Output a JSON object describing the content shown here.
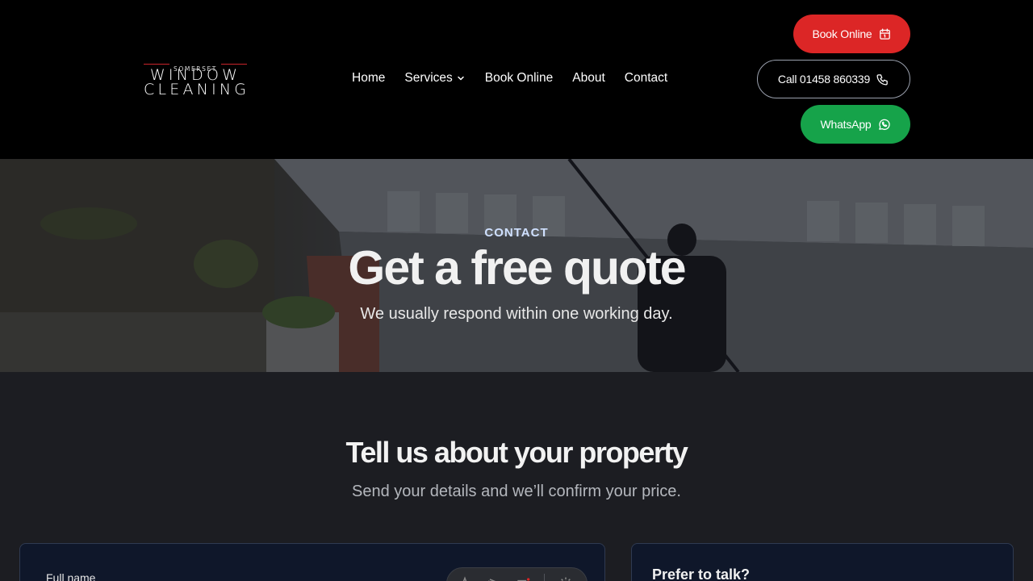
{
  "brand": {
    "logo_top": "SOMERSET",
    "logo_line1": "WINDOW",
    "logo_line2": "CLEANING"
  },
  "nav": {
    "items": [
      "Home",
      "Services",
      "Book Online",
      "About",
      "Contact"
    ]
  },
  "actions": {
    "book_label": "Book Online",
    "call_label": "Call 01458 860339",
    "whatsapp_label": "WhatsApp"
  },
  "hero": {
    "kicker": "CONTACT",
    "title": "Get a free quote",
    "subtitle": "We usually respond within one working day."
  },
  "section": {
    "title": "Tell us about your property",
    "subtitle": "Send your details and we’ll confirm your price."
  },
  "form": {
    "full_name_label": "Full name"
  },
  "talk": {
    "title": "Prefer to talk?"
  },
  "colors": {
    "accent_red": "#dc2626",
    "whatsapp_green": "#16a34a",
    "kicker_blue": "#cfe0ff"
  }
}
